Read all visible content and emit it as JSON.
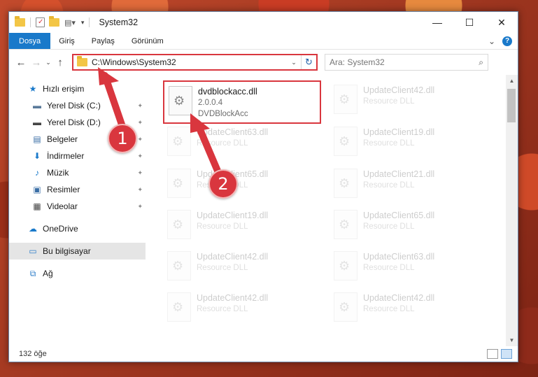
{
  "window": {
    "title": "System32",
    "controls": {
      "minimize": "—",
      "maximize": "☐",
      "close": "✕"
    }
  },
  "ribbon": {
    "tabs": [
      "Dosya",
      "Giriş",
      "Paylaş",
      "Görünüm"
    ],
    "collapse_glyph": "⌄",
    "help_glyph": "?"
  },
  "nav": {
    "back": "←",
    "forward": "→",
    "recent": "⌄",
    "up": "↑"
  },
  "address": {
    "path": "C:\\Windows\\System32",
    "dropdown": "⌄",
    "refresh": "↻"
  },
  "search": {
    "placeholder": "Ara: System32",
    "icon": "search-icon"
  },
  "sidebar": {
    "items": [
      {
        "label": "Hızlı erişim",
        "icon": "star-icon",
        "glyph": "★",
        "level": "top",
        "pinned": false
      },
      {
        "label": "Yerel Disk (C:)",
        "icon": "drive-icon",
        "glyph": "▬",
        "level": "sub",
        "pinned": true
      },
      {
        "label": "Yerel Disk (D:)",
        "icon": "drive-icon",
        "glyph": "▬",
        "level": "sub",
        "pinned": true
      },
      {
        "label": "Belgeler",
        "icon": "documents-icon",
        "glyph": "▤",
        "level": "sub",
        "pinned": true
      },
      {
        "label": "İndirmeler",
        "icon": "downloads-icon",
        "glyph": "⬇",
        "level": "sub",
        "pinned": true
      },
      {
        "label": "Müzik",
        "icon": "music-icon",
        "glyph": "♪",
        "level": "sub",
        "pinned": true
      },
      {
        "label": "Resimler",
        "icon": "pictures-icon",
        "glyph": "▣",
        "level": "sub",
        "pinned": true
      },
      {
        "label": "Videolar",
        "icon": "videos-icon",
        "glyph": "▦",
        "level": "sub",
        "pinned": true
      },
      {
        "label": "OneDrive",
        "icon": "cloud-icon",
        "glyph": "☁",
        "level": "top",
        "pinned": false
      },
      {
        "label": "Bu bilgisayar",
        "icon": "computer-icon",
        "glyph": "▭",
        "level": "top",
        "pinned": false,
        "selected": true
      },
      {
        "label": "Ağ",
        "icon": "network-icon",
        "glyph": "⧉",
        "level": "top",
        "pinned": false
      }
    ],
    "pin_glyph": "📌"
  },
  "files": [
    {
      "name": "dvdblockacc.dll",
      "line2": "2.0.0.4",
      "line3": "DVDBlockAcc",
      "highlight": true
    },
    {
      "name": "UpdateClient42.dll",
      "line2": "Resource DLL"
    },
    {
      "name": "UpdateClient63.dll",
      "line2": "Resource DLL"
    },
    {
      "name": "UpdateClient19.dll",
      "line2": "Resource DLL"
    },
    {
      "name": "UpdateClient65.dll",
      "line2": "Resource DLL"
    },
    {
      "name": "UpdateClient21.dll",
      "line2": "Resource DLL"
    },
    {
      "name": "UpdateClient19.dll",
      "line2": "Resource DLL"
    },
    {
      "name": "UpdateClient65.dll",
      "line2": "Resource DLL"
    },
    {
      "name": "UpdateClient42.dll",
      "line2": "Resource DLL"
    },
    {
      "name": "UpdateClient63.dll",
      "line2": "Resource DLL"
    },
    {
      "name": "UpdateClient42.dll",
      "line2": "Resource DLL"
    },
    {
      "name": "UpdateClient42.dll",
      "line2": "Resource DLL"
    }
  ],
  "status": {
    "item_count": "132 öğe"
  },
  "annotations": {
    "badge1": "1",
    "badge2": "2",
    "color": "#d9363e"
  }
}
